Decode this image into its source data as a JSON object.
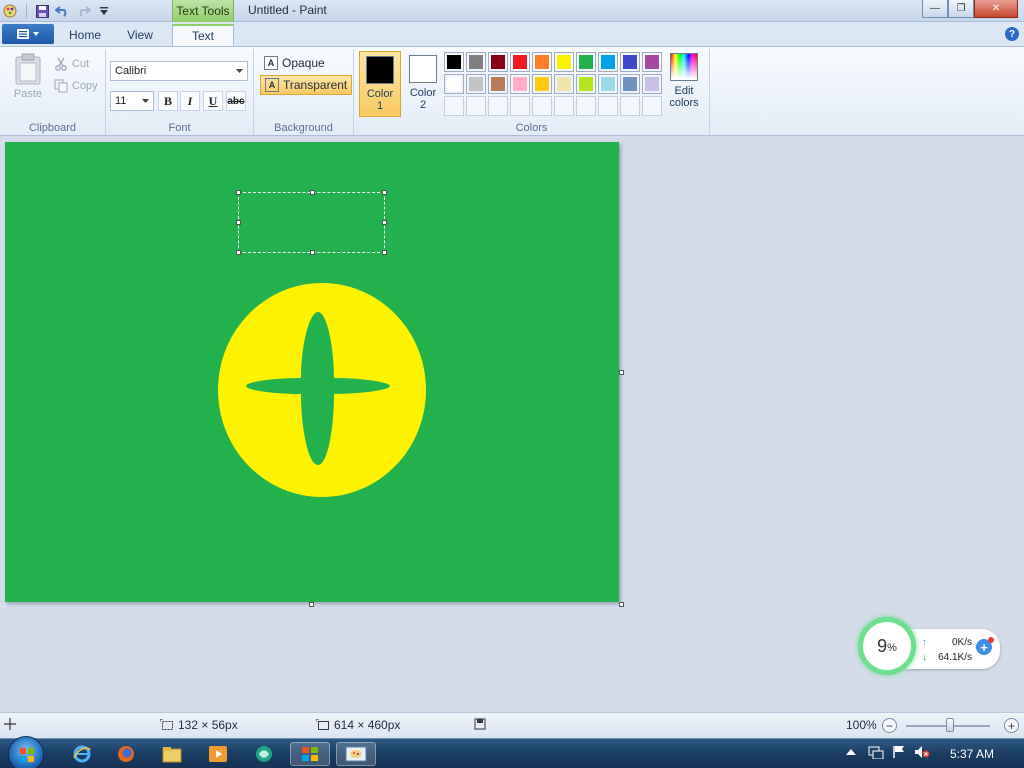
{
  "window": {
    "title": "Untitled - Paint",
    "contextual_tab": "Text Tools",
    "minimize_glyph": "—",
    "maximize_glyph": "❐",
    "close_glyph": "✕"
  },
  "tabs": [
    {
      "label": "Home",
      "active": false
    },
    {
      "label": "View",
      "active": false
    },
    {
      "label": "Text",
      "active": true
    }
  ],
  "help_glyph": "?",
  "clipboard": {
    "label": "Clipboard",
    "paste": "Paste",
    "cut": "Cut",
    "copy": "Copy"
  },
  "font": {
    "label": "Font",
    "family": "Calibri",
    "size": "11",
    "bold": "B",
    "italic": "I",
    "underline": "U",
    "strikethrough": "abc"
  },
  "background": {
    "label": "Background",
    "opaque": "Opaque",
    "transparent": "Transparent",
    "glyph": "A"
  },
  "colors": {
    "label": "Colors",
    "color1": {
      "label": "Color 1",
      "line1": "Color",
      "line2": "1",
      "value": "#000000"
    },
    "color2": {
      "label": "Color 2",
      "line1": "Color",
      "line2": "2",
      "value": "#ffffff"
    },
    "edit_colors": "Edit colors",
    "edit_line1": "Edit",
    "edit_line2": "colors",
    "palette_row1": [
      "#000000",
      "#7f7f7f",
      "#880015",
      "#ed1c24",
      "#ff7f27",
      "#fff200",
      "#22b14c",
      "#00a2e8",
      "#3f48cc",
      "#a349a4"
    ],
    "palette_row2": [
      "#ffffff",
      "#c3c3c3",
      "#b97a57",
      "#ffaec9",
      "#ffc90e",
      "#efe4b0",
      "#b5e61d",
      "#99d9ea",
      "#7092be",
      "#c8bfe7"
    ],
    "palette_row3_count": 10
  },
  "canvas": {
    "background": "#22b14c",
    "circle_color": "#fff200",
    "star_color": "#22b14c"
  },
  "network_widget": {
    "cpu_value": "9",
    "cpu_unit": "%",
    "upload": "0K/s",
    "download": "64.1K/s",
    "up_arrow": "↑",
    "down_arrow": "↓",
    "plus": "+"
  },
  "statusbar": {
    "selection_size": "132 × 56px",
    "canvas_size": "614 × 460px",
    "zoom": "100%",
    "zoom_out": "−",
    "zoom_in": "+"
  },
  "taskbar": {
    "time": "5:37 AM"
  }
}
